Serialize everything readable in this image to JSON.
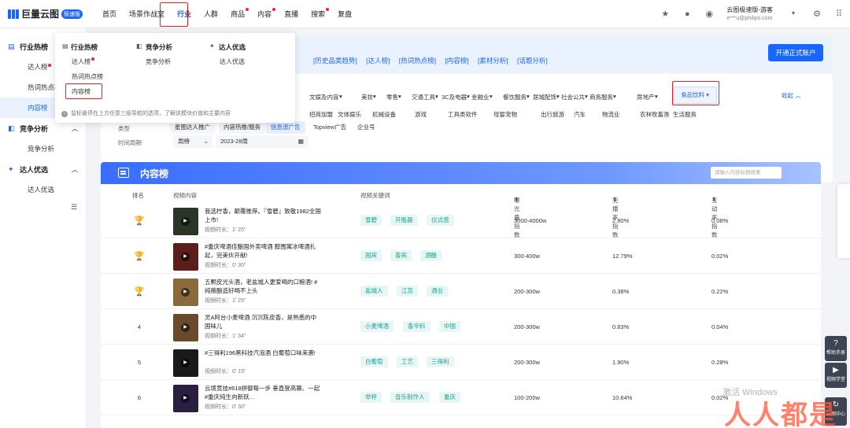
{
  "app": {
    "name": "巨量云图",
    "badge": "极速版"
  },
  "nav": [
    {
      "label": "首页",
      "dot": false
    },
    {
      "label": "场景作战室",
      "dot": false
    },
    {
      "label": "行业",
      "dot": false,
      "active": true
    },
    {
      "label": "人群",
      "dot": false
    },
    {
      "label": "商品",
      "dot": true
    },
    {
      "label": "内容",
      "dot": true
    },
    {
      "label": "直播",
      "dot": false
    },
    {
      "label": "搜索",
      "dot": true
    },
    {
      "label": "复盘",
      "dot": false
    }
  ],
  "user": {
    "name": "云图极速版-游客",
    "email": "e***u@philips.com"
  },
  "sidebar": {
    "groups": [
      {
        "label": "行业热榜",
        "items": [
          {
            "label": "达人榜",
            "dot": true
          },
          {
            "label": "热词热点榜"
          },
          {
            "label": "内容榜",
            "active": true
          }
        ]
      },
      {
        "label": "竞争分析",
        "items": [
          {
            "label": "竞争分析"
          }
        ]
      },
      {
        "label": "达人优选",
        "items": [
          {
            "label": "达人优选"
          }
        ]
      }
    ]
  },
  "dropdown": {
    "columns": [
      {
        "title": "行业热榜",
        "items": [
          {
            "label": "达人榜",
            "dot": true
          },
          {
            "label": "热词热点榜"
          },
          {
            "label": "内容榜"
          }
        ]
      },
      {
        "title": "竞争分析",
        "items": [
          {
            "label": "竞争分析"
          }
        ]
      },
      {
        "title": "达人优选",
        "items": [
          {
            "label": "达人优选"
          }
        ]
      }
    ],
    "footer": "鼠标悬停在上方任意三级导航的选项，了解该模块价值和主要内容"
  },
  "notice": {
    "links": [
      "[历史品类趋势]",
      "[达人榜]",
      "[热词热点榜]",
      "[内容榜]",
      "[素材分析]",
      "[话题分析]"
    ],
    "button": "开通正式账户"
  },
  "filter": {
    "categories_row1": [
      "文娱及内容",
      "美妆",
      "零售",
      "交通工具",
      "3C及电器",
      "金融业",
      "餐饮服务",
      "居城配饰",
      "社会公共",
      "商务服务",
      "食品饮料",
      "房地产"
    ],
    "categories_row2": [
      "招商加盟",
      "文体娱乐",
      "机械设备",
      "游戏",
      "工具类软件",
      "母婴宠物",
      "出行旅游",
      "汽车",
      "物流业",
      "农林牧畜渔",
      "生活服务"
    ],
    "selected_category": "食品饮料",
    "collapse": "收起",
    "type_label": "类型",
    "types": [
      "星图达人推广",
      "内容热推/服务",
      "信息流广告",
      "Topview广告",
      "企业号"
    ],
    "selected_type": "信息流广告",
    "period_label": "时间周期",
    "period_unit": "周榜",
    "period_value": "2023-28周"
  },
  "panel": {
    "title": "内容榜",
    "search_placeholder": "请输入内容标题搜索",
    "headers": [
      "排名",
      "视频内容",
      "视频关键词",
      "曝光量指数",
      "完播率指数",
      "互动率指数"
    ]
  },
  "rows": [
    {
      "rank": "1",
      "trophy": "gold",
      "title": "我选柠香，颠覆推荐。『雪碧』致敬1982全国上市!",
      "duration": "视频时长：1' 25\"",
      "tags": [
        "雪碧",
        "开瓶器",
        "仪式感"
      ],
      "exposure": "3000-4000w",
      "completion": "2.80%",
      "interaction": "0.08%"
    },
    {
      "rank": "2",
      "trophy": "silver",
      "title": "#重庆啤酒佳酿国外卖啤酒 醇围寓冰啤酒扎起，完美伙开献!",
      "duration": "视频时长：0' 30\"",
      "tags": [
        "国宾",
        "香宾",
        "酒酿"
      ],
      "exposure": "300-400w",
      "completion": "12.79%",
      "interaction": "0.02%"
    },
    {
      "rank": "3",
      "trophy": "bronze",
      "title": "五颗皮光头酒，老盐城人更爱喝的口粮酒! #纯粮酿造好喝不上头",
      "duration": "视频时长：1' 25\"",
      "tags": [
        "盐城人",
        "江苏",
        "酒业"
      ],
      "exposure": "200-300w",
      "completion": "0.38%",
      "interaction": "0.22%"
    },
    {
      "rank": "4",
      "trophy": "",
      "title": "灵A阿台小麦啤酒 沉沉陈皮香，是熟悉的中国味儿",
      "duration": "视频时长：1' 34\"",
      "tags": [
        "小麦啤酒",
        "香辛料",
        "中国"
      ],
      "exposure": "200-300w",
      "completion": "0.83%",
      "interaction": "0.04%"
    },
    {
      "rank": "5",
      "trophy": "",
      "title": "#三得利196黑科技汽泡酒 白葡萄口味来袭!",
      "duration": "视频时长：0' 15\"",
      "tags": [
        "白葡萄",
        "工艺",
        "三得利"
      ],
      "exposure": "200-300w",
      "completion": "1.90%",
      "interaction": "0.28%"
    },
    {
      "rank": "6",
      "trophy": "",
      "title": "云境竞技#618拼御每一步 垂直登高赛、一起#重庆纯生向新跃...",
      "duration": "视频时长：0' 30\"",
      "tags": [
        "举杯",
        "音乐制作人",
        "重庆"
      ],
      "exposure": "100-200w",
      "completion": "10.64%",
      "interaction": "0.02%"
    }
  ],
  "floating": {
    "help": "帮助手册",
    "video": "视频学堂",
    "cloud": "云图中心"
  },
  "overlay": {
    "windows": "激活 Windows",
    "brand": "人人都是"
  },
  "colors": {
    "primary": "#1966ff",
    "tag_bg": "#e8f7f5",
    "tag_text": "#15a495",
    "highlight": "#e02020"
  }
}
